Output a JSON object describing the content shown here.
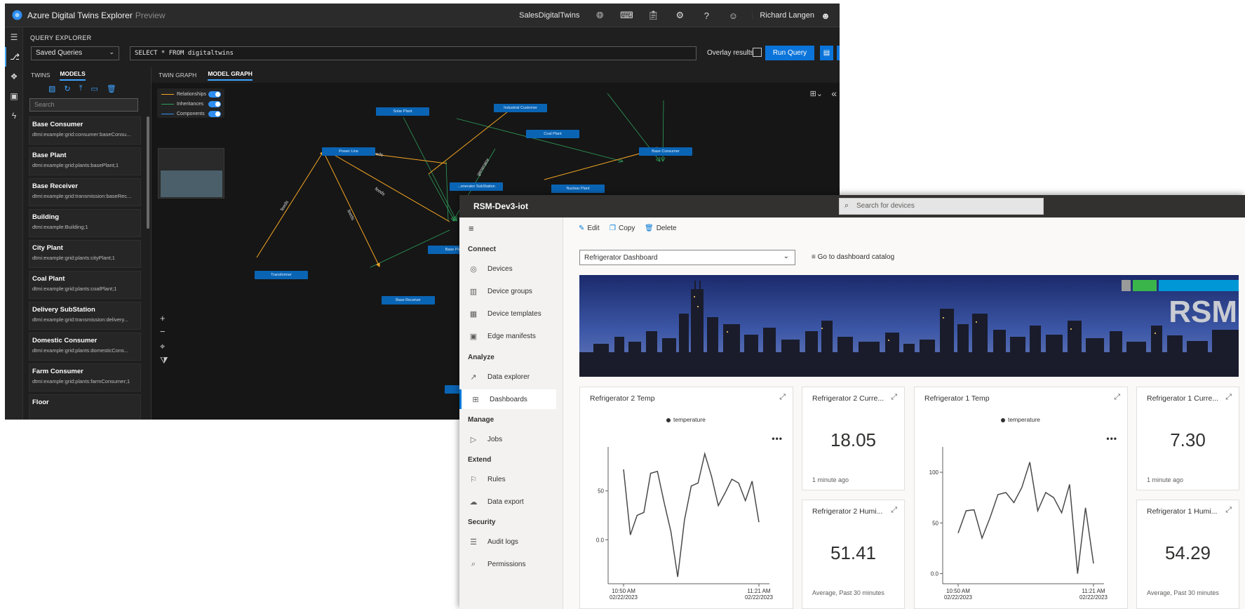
{
  "adt": {
    "title": "Azure Digital Twins Explorer",
    "preview": "Preview",
    "env": "SalesDigitalTwins",
    "user": "Richard Langen",
    "query_explorer_label": "QUERY EXPLORER",
    "saved_queries": "Saved Queries",
    "query": "SELECT * FROM digitaltwins",
    "overlay_label": "Overlay results",
    "run_query": "Run Query",
    "left_tabs": [
      "TWINS",
      "MODELS"
    ],
    "search_placeholder": "Search",
    "models": [
      {
        "name": "Base Consumer",
        "id": "dtmi:example:grid:consumer:baseConsu..."
      },
      {
        "name": "Base Plant",
        "id": "dtmi:example:grid:plants:basePlant;1"
      },
      {
        "name": "Base Receiver",
        "id": "dtmi:example:grid:transmission:baseRec..."
      },
      {
        "name": "Building",
        "id": "dtmi:example:Building;1"
      },
      {
        "name": "City Plant",
        "id": "dtmi:example:grid:plants:cityPlant;1"
      },
      {
        "name": "Coal Plant",
        "id": "dtmi:example:grid:plants:coalPlant;1"
      },
      {
        "name": "Delivery SubStation",
        "id": "dtmi:example:grid:transmission:delivery..."
      },
      {
        "name": "Domestic Consumer",
        "id": "dtmi:example:grid:plants:domesticCons..."
      },
      {
        "name": "Farm Consumer",
        "id": "dtmi:example:grid:plants:farmConsumer;1"
      },
      {
        "name": "Floor",
        "id": ""
      }
    ],
    "graph_tabs": [
      "TWIN GRAPH",
      "MODEL GRAPH"
    ],
    "legend": [
      "Relationships",
      "Inheritances",
      "Components"
    ],
    "nodes": {
      "solar_plant": "Solar Plant",
      "industrial_consumer": "Industrial Customer",
      "coal_plant": "Coal Plant",
      "power_line": "Power Line",
      "substation": "...enerator SubStation",
      "base_consumer": "Base Consumer",
      "nuclear_plant": "Nuclear Plant",
      "base_plant": "Base Plant",
      "transformer": "Transformer",
      "base_receiver": "Base Receiver"
    },
    "edge_labels": {
      "feeds": "feeds",
      "generator": "generator"
    },
    "colors": {
      "relationship": "#f5a623",
      "inheritance": "#2e9e5b",
      "component": "#2f8ef0",
      "accent": "#0a74da"
    }
  },
  "iot": {
    "app_name": "RSM-Dev3-iot",
    "search_placeholder": "Search for devices",
    "nav": [
      {
        "section": "Connect"
      },
      {
        "label": "Devices",
        "icon": "devices-icon"
      },
      {
        "label": "Device groups",
        "icon": "device-groups-icon"
      },
      {
        "label": "Device templates",
        "icon": "device-templates-icon"
      },
      {
        "label": "Edge manifests",
        "icon": "edge-manifests-icon"
      },
      {
        "section": "Analyze"
      },
      {
        "label": "Data explorer",
        "icon": "data-explorer-icon"
      },
      {
        "label": "Dashboards",
        "icon": "dashboards-icon",
        "selected": true
      },
      {
        "section": "Manage"
      },
      {
        "label": "Jobs",
        "icon": "jobs-icon"
      },
      {
        "section": "Extend"
      },
      {
        "label": "Rules",
        "icon": "rules-icon"
      },
      {
        "label": "Data export",
        "icon": "data-export-icon"
      },
      {
        "section": "Security"
      },
      {
        "label": "Audit logs",
        "icon": "audit-logs-icon"
      },
      {
        "label": "Permissions",
        "icon": "permissions-icon"
      }
    ],
    "commands": {
      "edit": "Edit",
      "copy": "Copy",
      "delete": "Delete"
    },
    "dashboard": "Refrigerator Dashboard",
    "catalog_link": "Go to dashboard catalog",
    "banner_text": "RSM",
    "tiles": {
      "r2_temp": {
        "title": "Refrigerator 2 Temp",
        "legend": "temperature"
      },
      "r2_current": {
        "title": "Refrigerator 2 Curre...",
        "value": "18.05",
        "sub": "1 minute ago"
      },
      "r2_humidity": {
        "title": "Refrigerator 2 Humi...",
        "value": "51.41",
        "sub": "Average, Past 30 minutes"
      },
      "r1_temp": {
        "title": "Refrigerator 1 Temp",
        "legend": "temperature"
      },
      "r1_current": {
        "title": "Refrigerator 1 Curre...",
        "value": "7.30",
        "sub": "1 minute ago"
      },
      "r1_humidity": {
        "title": "Refrigerator 1 Humi...",
        "value": "54.29",
        "sub": "Average, Past 30 minutes"
      }
    },
    "colors": {
      "nav_accent": "#0078d4",
      "topbar": "#323130"
    }
  },
  "chart_data": [
    {
      "type": "line",
      "title": "Refrigerator 2 Temp",
      "series": [
        {
          "name": "temperature",
          "values": [
            72,
            5,
            25,
            28,
            68,
            70,
            38,
            8,
            -38,
            20,
            55,
            58,
            88,
            65,
            35,
            48,
            62,
            58,
            40,
            60,
            18
          ]
        }
      ],
      "x_ticks": [
        "10:50 AM\n02/22/2023",
        "11:21 AM\n02/22/2023"
      ],
      "y_ticks": [
        "0.0",
        "50"
      ],
      "ylim": [
        -45,
        95
      ]
    },
    {
      "type": "line",
      "title": "Refrigerator 1 Temp",
      "series": [
        {
          "name": "temperature",
          "values": [
            40,
            62,
            63,
            35,
            55,
            78,
            80,
            70,
            85,
            110,
            62,
            80,
            75,
            60,
            88,
            0,
            65,
            10
          ]
        }
      ],
      "x_ticks": [
        "10:50 AM\n02/22/2023",
        "11:21 AM\n02/22/2023"
      ],
      "y_ticks": [
        "0.0",
        "50",
        "100"
      ],
      "ylim": [
        -10,
        125
      ]
    }
  ]
}
